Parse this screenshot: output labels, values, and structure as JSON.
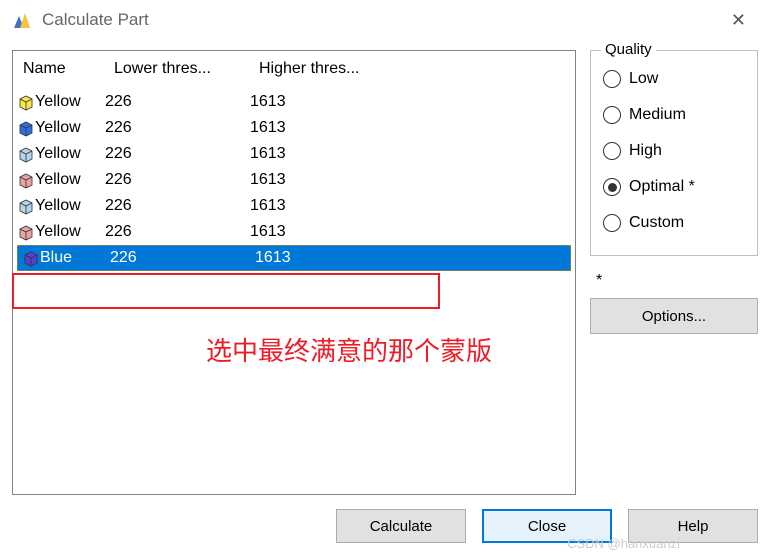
{
  "window": {
    "title": "Calculate Part"
  },
  "table": {
    "headers": {
      "name": "Name",
      "lower": "Lower thres...",
      "higher": "Higher thres..."
    },
    "rows": [
      {
        "name": "Yellow",
        "lower": "226",
        "higher": "1613",
        "color": "#f7e84a",
        "selected": false
      },
      {
        "name": "Yellow",
        "lower": "226",
        "higher": "1613",
        "color": "#2f6de0",
        "selected": false
      },
      {
        "name": "Yellow",
        "lower": "226",
        "higher": "1613",
        "color": "#b5d4e9",
        "selected": false
      },
      {
        "name": "Yellow",
        "lower": "226",
        "higher": "1613",
        "color": "#e9a2a2",
        "selected": false
      },
      {
        "name": "Yellow",
        "lower": "226",
        "higher": "1613",
        "color": "#b5d4e9",
        "selected": false
      },
      {
        "name": "Yellow",
        "lower": "226",
        "higher": "1613",
        "color": "#e9a2a2",
        "selected": false
      },
      {
        "name": "Blue",
        "lower": "226",
        "higher": "1613",
        "color": "#5a3fd6",
        "selected": true
      }
    ]
  },
  "quality": {
    "legend": "Quality",
    "options": [
      {
        "label": "Low",
        "selected": false
      },
      {
        "label": "Medium",
        "selected": false
      },
      {
        "label": "High",
        "selected": false
      },
      {
        "label": "Optimal *",
        "selected": true
      },
      {
        "label": "Custom",
        "selected": false
      }
    ],
    "asterisk": "*",
    "options_btn": "Options..."
  },
  "buttons": {
    "calculate": "Calculate",
    "close": "Close",
    "help": "Help"
  },
  "annotation": {
    "text": "选中最终满意的那个蒙版"
  },
  "watermark": "CSDN @hanxuanzi"
}
